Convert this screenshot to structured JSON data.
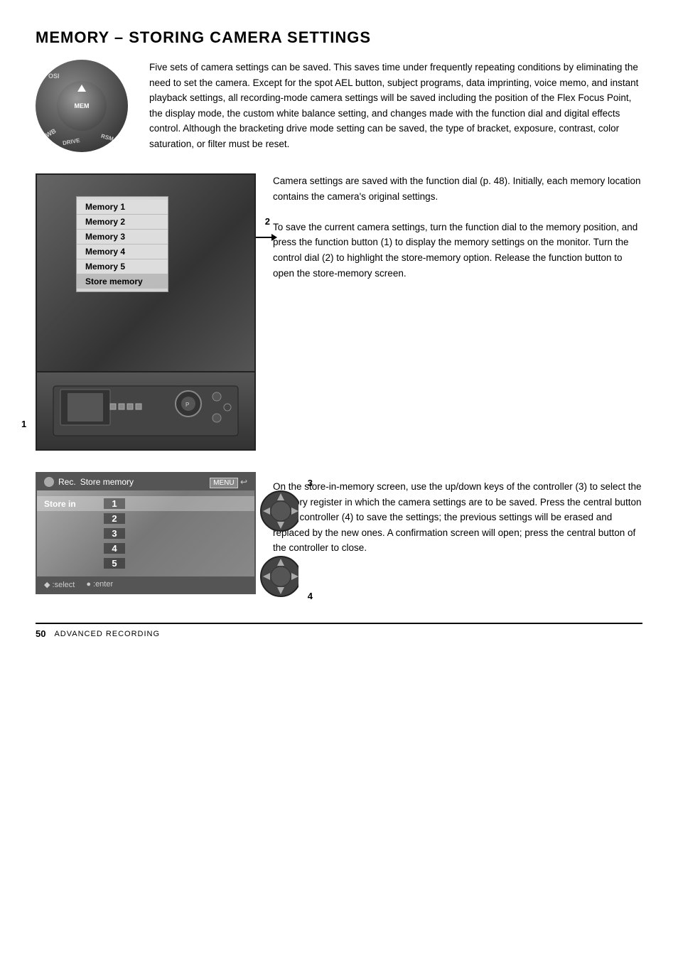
{
  "page": {
    "title": "MEMORY – STORING CAMERA SETTINGS",
    "footer_page": "50",
    "footer_chapter": "Advanced Recording"
  },
  "intro_text": "Five sets of camera settings can be saved. This saves time under frequently repeating conditions by eliminating the need to set the camera. Except for the spot AEL button, subject programs, data imprinting, voice memo, and instant playback settings, all recording-mode camera settings will be saved including the position of the Flex Focus Point, the display mode, the custom white balance setting, and changes made with the function dial and digital effects control. Although the bracketing drive mode setting can be saved, the type of bracket, exposure, contrast, color saturation, or filter must be reset.",
  "dial": {
    "mem_label": "MEM",
    "osi_label": "OSI",
    "wb_label": "WB",
    "drive_label": "DRIVE",
    "rsm_label": "RSM"
  },
  "menu": {
    "items": [
      {
        "label": "Memory  1"
      },
      {
        "label": "Memory  2"
      },
      {
        "label": "Memory  3"
      },
      {
        "label": "Memory  4"
      },
      {
        "label": "Memory  5"
      },
      {
        "label": "Store memory"
      }
    ]
  },
  "mid_text": "Camera settings are saved with the function dial (p. 48). Initially, each memory location contains the camera's original settings.\n\nTo save the current camera settings, turn the function dial to the memory position, and press the function button (1) to display the memory settings on the monitor. Turn the control dial (2) to highlight the store-memory option. Release the function button to open the store-memory screen.",
  "label_1": "1",
  "label_2": "2",
  "store_screen": {
    "header_rec": "Rec.",
    "header_title": "Store memory",
    "menu_btn": "MENU",
    "store_in": "Store in",
    "rows": [
      "1",
      "2",
      "3",
      "4",
      "5"
    ],
    "footer_select": "◆ :select",
    "footer_enter": "● :enter"
  },
  "bottom_text": "On the store-in-memory screen, use the up/down keys of the controller (3) to select the memory register in which the camera settings are to be saved. Press the central button of the controller (4) to save the settings; the previous settings will be erased and replaced by the new ones. A confirmation screen will open; press the central button of the controller to close.",
  "label_3": "3",
  "label_4": "4"
}
